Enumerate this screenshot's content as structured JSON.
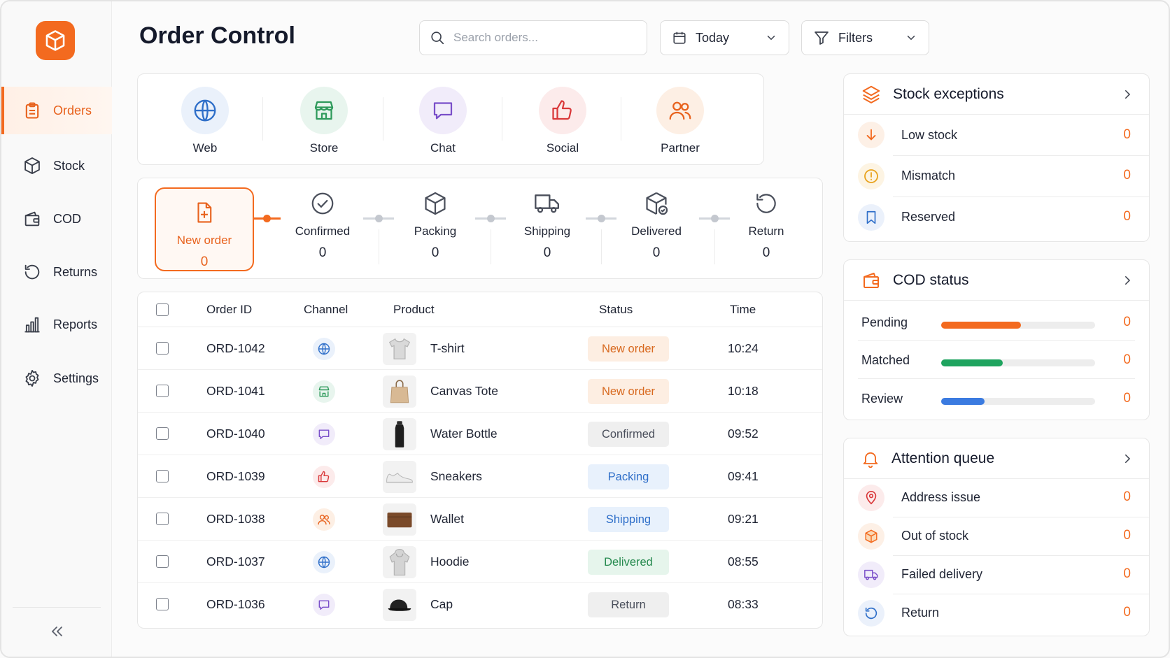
{
  "app": {
    "title": "Order Control",
    "accent": "#f36a1f"
  },
  "sidebar": {
    "items": [
      {
        "label": "Orders",
        "icon": "clipboard-icon",
        "active": true
      },
      {
        "label": "Stock",
        "icon": "box-icon"
      },
      {
        "label": "COD",
        "icon": "wallet-icon"
      },
      {
        "label": "Returns",
        "icon": "return-icon"
      },
      {
        "label": "Reports",
        "icon": "bar-chart-icon"
      },
      {
        "label": "Settings",
        "icon": "gear-icon"
      }
    ],
    "collapse_icon": "double-chevron-left-icon"
  },
  "header": {
    "search": {
      "placeholder": "Search orders...",
      "value": ""
    },
    "date_filter": {
      "label": "Today",
      "icon": "calendar-icon"
    },
    "filters": {
      "label": "Filters",
      "icon": "funnel-icon"
    }
  },
  "channels": [
    {
      "label": "Web",
      "icon": "globe-icon",
      "color": "#2f6fc9"
    },
    {
      "label": "Store",
      "icon": "store-icon",
      "color": "#2e9a5b"
    },
    {
      "label": "Chat",
      "icon": "chat-icon",
      "color": "#7a4fc9"
    },
    {
      "label": "Social",
      "icon": "thumbs-up-icon",
      "color": "#d9383a"
    },
    {
      "label": "Partner",
      "icon": "users-icon",
      "color": "#e8621d"
    }
  ],
  "pipeline": [
    {
      "name": "New order",
      "count": "0",
      "icon": "file-plus-icon",
      "active": true
    },
    {
      "name": "Confirmed",
      "count": "0",
      "icon": "check-circle-icon"
    },
    {
      "name": "Packing",
      "count": "0",
      "icon": "box-icon"
    },
    {
      "name": "Shipping",
      "count": "0",
      "icon": "truck-icon"
    },
    {
      "name": "Delivered",
      "count": "0",
      "icon": "box-check-icon"
    },
    {
      "name": "Return",
      "count": "0",
      "icon": "return-icon"
    }
  ],
  "orders": {
    "columns": {
      "order_id": "Order ID",
      "channel": "Channel",
      "product": "Product",
      "status": "Status",
      "time": "Time"
    },
    "rows": [
      {
        "id": "ORD-1042",
        "channel": "globe-icon",
        "product": "T-shirt",
        "product_icon": "tshirt-icon",
        "status": "New order",
        "time": "10:24"
      },
      {
        "id": "ORD-1041",
        "channel": "store-icon",
        "product": "Canvas Tote",
        "product_icon": "tote-bag-icon",
        "status": "New order",
        "time": "10:18"
      },
      {
        "id": "ORD-1040",
        "channel": "chat-icon",
        "product": "Water Bottle",
        "product_icon": "bottle-icon",
        "status": "Confirmed",
        "time": "09:52"
      },
      {
        "id": "ORD-1039",
        "channel": "thumbs-up-icon",
        "product": "Sneakers",
        "product_icon": "sneaker-icon",
        "status": "Packing",
        "time": "09:41"
      },
      {
        "id": "ORD-1038",
        "channel": "users-icon",
        "product": "Wallet",
        "product_icon": "wallet-icon",
        "status": "Shipping",
        "time": "09:21"
      },
      {
        "id": "ORD-1037",
        "channel": "globe-icon",
        "product": "Hoodie",
        "product_icon": "hoodie-icon",
        "status": "Delivered",
        "time": "08:55"
      },
      {
        "id": "ORD-1036",
        "channel": "chat-icon",
        "product": "Cap",
        "product_icon": "cap-icon",
        "status": "Return",
        "time": "08:33"
      }
    ]
  },
  "stock_exceptions": {
    "title": "Stock exceptions",
    "items": [
      {
        "label": "Low stock",
        "value": "0",
        "icon": "arrow-down-icon"
      },
      {
        "label": "Mismatch",
        "value": "0",
        "icon": "alert-circle-icon"
      },
      {
        "label": "Reserved",
        "value": "0",
        "icon": "bookmark-icon"
      }
    ]
  },
  "cod_status": {
    "title": "COD status",
    "items": [
      {
        "label": "Pending",
        "value": "0",
        "progress": 0.52,
        "color": "#f36a1f"
      },
      {
        "label": "Matched",
        "value": "0",
        "progress": 0.4,
        "color": "#1fa45f"
      },
      {
        "label": "Review",
        "value": "0",
        "progress": 0.28,
        "color": "#3b7be0"
      }
    ]
  },
  "attention_queue": {
    "title": "Attention queue",
    "items": [
      {
        "label": "Address issue",
        "value": "0",
        "icon": "map-pin-icon"
      },
      {
        "label": "Out of stock",
        "value": "0",
        "icon": "box-icon"
      },
      {
        "label": "Failed delivery",
        "value": "0",
        "icon": "truck-icon"
      },
      {
        "label": "Return",
        "value": "0",
        "icon": "return-icon"
      }
    ]
  }
}
